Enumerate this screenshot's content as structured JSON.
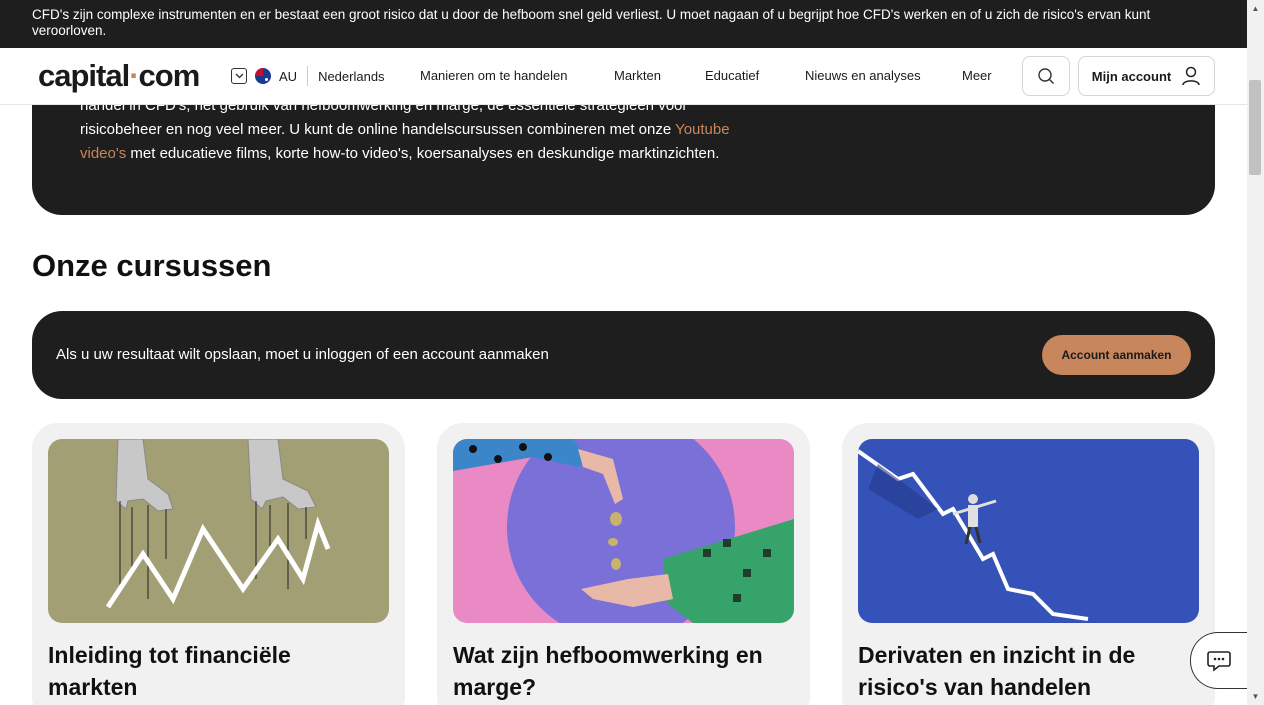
{
  "risk_banner": {
    "text": "CFD's zijn complexe instrumenten en er bestaat een groot risico dat u door de hefboom snel geld verliest. U moet nagaan of u begrijpt hoe CFD's werken en of u zich de risico's ervan kunt veroorloven."
  },
  "header": {
    "logo_part1": "capital",
    "logo_dot": "·",
    "logo_part2": "com",
    "region_code": "AU",
    "language": "Nederlands",
    "nav": [
      "Manieren om te handelen",
      "Markten",
      "Educatief",
      "Nieuws en analyses",
      "Meer"
    ],
    "account_label": "Mijn account"
  },
  "intro": {
    "line1": "handel in CFD's, het gebruik van hefboomwerking en marge, de essentiële strategieën voor",
    "line2": "risicobeheer en nog veel meer. U kunt de online handelscursussen combineren met onze ",
    "link_text_1": "Youtube",
    "link_text_2": "video's",
    "line3_rest": " met educatieve films, korte how-to video's, koersanalyses en deskundige marktinzichten."
  },
  "courses": {
    "section_title": "Onze cursussen",
    "login_prompt": "Als u uw resultaat wilt opslaan, moet u inloggen of een account aanmaken",
    "create_account_label": "Account aanmaken",
    "cards": [
      {
        "title": "Inleiding tot financiële markten"
      },
      {
        "title": "Wat zijn hefboomwerking en marge?"
      },
      {
        "title": "Derivaten en inzicht in de risico's van handelen"
      }
    ]
  },
  "colors": {
    "dark": "#1f1e1e",
    "accent": "#c7865c",
    "card_bg": "#f1f1f2"
  },
  "icons": {
    "search": "search-icon",
    "account": "user-icon",
    "chat": "chat-icon",
    "language_dropdown": "chevron-down-icon"
  }
}
